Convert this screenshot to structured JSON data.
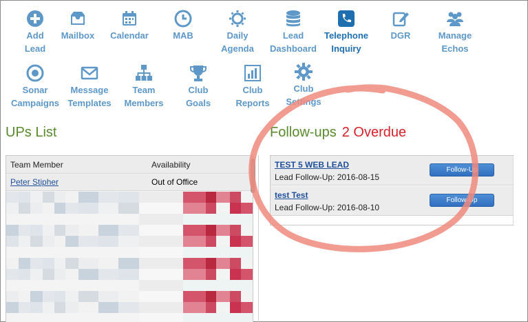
{
  "nav": {
    "items": [
      {
        "key": "add-lead",
        "label": "Add\nLead",
        "icon": "plus-circle-icon"
      },
      {
        "key": "mailbox",
        "label": "Mailbox",
        "icon": "inbox-icon"
      },
      {
        "key": "calendar",
        "label": "Calendar",
        "icon": "calendar-icon"
      },
      {
        "key": "mab",
        "label": "MAB",
        "icon": "clock-icon"
      },
      {
        "key": "daily-agenda",
        "label": "Daily\nAgenda",
        "icon": "sun-icon"
      },
      {
        "key": "lead-dashboard",
        "label": "Lead\nDashboard",
        "icon": "database-icon"
      },
      {
        "key": "telephone-inquiry",
        "label": "Telephone\nInquiry",
        "icon": "phone-icon"
      },
      {
        "key": "dgr",
        "label": "DGR",
        "icon": "edit-icon"
      },
      {
        "key": "manage-echos",
        "label": "Manage\nEchos",
        "icon": "users-icon"
      },
      {
        "key": "sonar-campaigns",
        "label": "Sonar\nCampaigns",
        "icon": "target-icon"
      },
      {
        "key": "message-templates",
        "label": "Message\nTemplates",
        "icon": "envelope-icon"
      },
      {
        "key": "team-members",
        "label": "Team\nMembers",
        "icon": "org-chart-icon"
      },
      {
        "key": "club-goals",
        "label": "Club\nGoals",
        "icon": "trophy-icon"
      },
      {
        "key": "club-reports",
        "label": "Club\nReports",
        "icon": "bar-chart-icon"
      },
      {
        "key": "club-settings",
        "label": "Club\nSettings",
        "icon": "gear-icon"
      }
    ]
  },
  "ups": {
    "title": "UPs List",
    "col_member": "Team Member",
    "col_availability": "Availability",
    "rows": [
      {
        "member": "Peter Stipher",
        "availability": "Out of Office"
      }
    ]
  },
  "followups": {
    "title": "Follow-ups",
    "overdue": "2 Overdue",
    "button_label": "Follow-Up",
    "items": [
      {
        "name": "TEST 5 WEB LEAD",
        "date": "Lead Follow-Up: 2016-08-15"
      },
      {
        "name": "test Test",
        "date": "Lead Follow-Up: 2016-08-10"
      }
    ]
  },
  "colors": {
    "nav_text": "#5e98c9",
    "title_green": "#5a8a2e",
    "overdue_red": "#d9222a",
    "annotation_circle": "#ef8a7e",
    "button_blue": "#3a7cca"
  }
}
